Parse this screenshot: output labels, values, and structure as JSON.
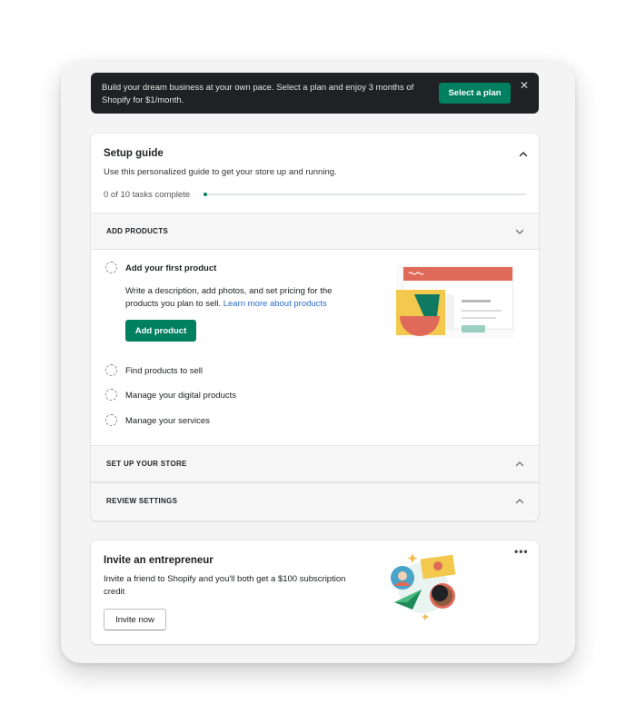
{
  "banner": {
    "text": "Build your dream business at your own pace. Select a plan and enjoy 3 months of Shopify for $1/month.",
    "button_label": "Select a plan",
    "close_icon": "close-icon"
  },
  "setup_guide": {
    "title": "Setup guide",
    "subtitle": "Use this personalized guide to get your store up and running.",
    "progress_text": "0 of 10 tasks complete",
    "progress_completed": 0,
    "progress_total": 10,
    "collapse_icon": "chevron-up-icon",
    "sections": {
      "add_products": {
        "label": "ADD PRODUCTS",
        "icon": "chevron-down-icon",
        "active_task": {
          "title": "Add your first product",
          "description": "Write a description, add photos, and set pricing for the products you plan to sell.",
          "link_text": "Learn more about products",
          "button_label": "Add product"
        },
        "tasks": [
          {
            "label": "Find products to sell"
          },
          {
            "label": "Manage your digital products"
          },
          {
            "label": "Manage your services"
          }
        ]
      },
      "set_up_store": {
        "label": "SET UP YOUR STORE",
        "icon": "chevron-up-icon"
      },
      "review_settings": {
        "label": "REVIEW SETTINGS",
        "icon": "chevron-up-icon"
      }
    }
  },
  "invite": {
    "title": "Invite an entrepreneur",
    "description": "Invite a friend to Shopify and you'll both get a $100 subscription credit",
    "button_label": "Invite now",
    "more_icon": "more-horizontal-icon"
  },
  "colors": {
    "primary": "#008060",
    "banner_bg": "#1f2124",
    "link": "#2c6ecb"
  }
}
